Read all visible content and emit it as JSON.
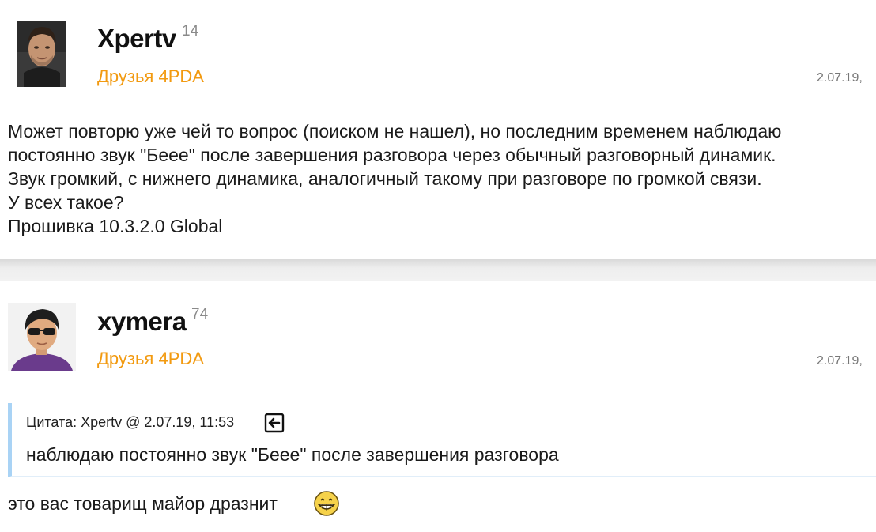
{
  "posts": [
    {
      "author": "Xpertv",
      "reputation": "14",
      "group": "Друзья 4PDA",
      "date": "2.07.19,",
      "body_lines": [
        "Может повторю уже чей то вопрос (поиском не нашел), но последним временем наблюдаю",
        "постоянно звук \"Беее\" после завершения разговора через обычный разговорный динамик.",
        "Звук громкий, с нижнего динамика, аналогичный такому при разговоре по громкой связи.",
        "У всех такое?",
        "Прошивка 10.3.2.0 Global"
      ]
    },
    {
      "author": "xymera",
      "reputation": "74",
      "group": "Друзья 4PDA",
      "date": "2.07.19,",
      "quote": {
        "header": "Цитата: Xpertv @ 2.07.19, 11:53",
        "text": "наблюдаю постоянно звук \"Беее\" после завершения разговора",
        "jump_icon": "jump-to-quote-icon"
      },
      "reply_text": "это вас товарищ майор дразнит",
      "smile_icon": "grin-smiley-icon"
    }
  ],
  "colors": {
    "group": "#f29a10",
    "quote_border": "#a9d3f5",
    "separator": "#e6e6e6"
  }
}
